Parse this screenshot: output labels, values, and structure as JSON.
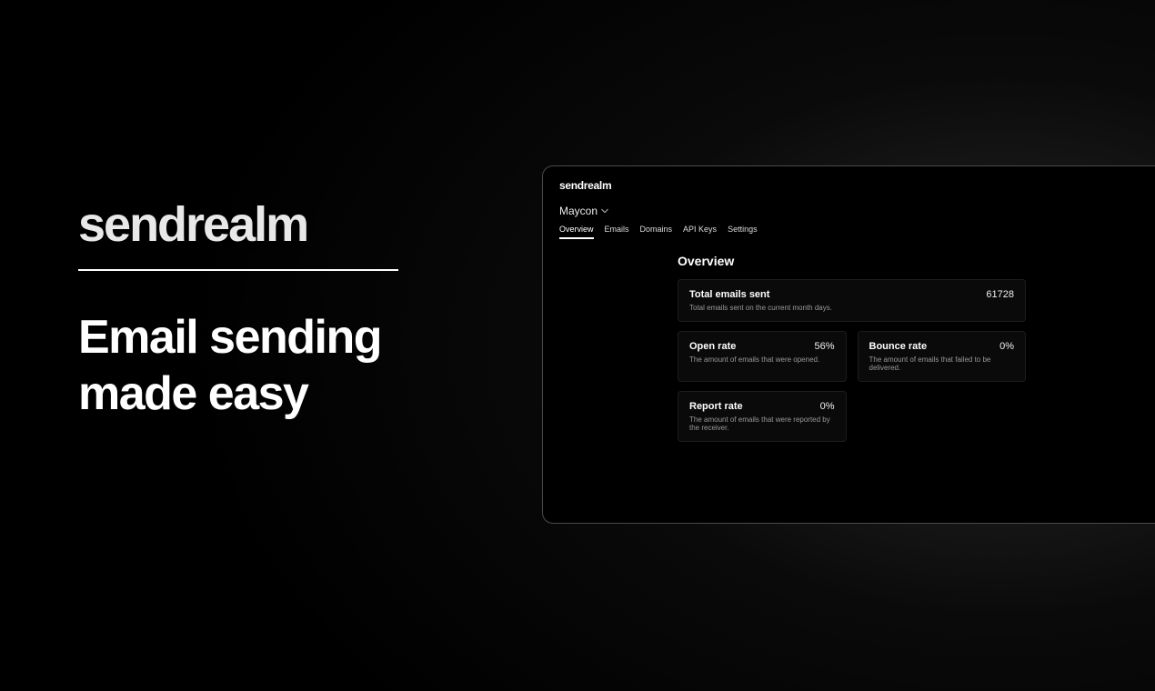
{
  "hero": {
    "brand": "sendrealm",
    "tagline": "Email sending\nmade easy"
  },
  "app": {
    "brand": "sendrealm",
    "user_name": "Maycon",
    "tabs": {
      "overview": "Overview",
      "emails": "Emails",
      "domains": "Domains",
      "api_keys": "API Keys",
      "settings": "Settings"
    },
    "main": {
      "heading": "Overview",
      "cards": {
        "total_sent": {
          "title": "Total emails sent",
          "value": "61728",
          "desc": "Total emails sent on the current month days."
        },
        "open_rate": {
          "title": "Open rate",
          "value": "56%",
          "desc": "The amount of emails that were opened."
        },
        "bounce_rate": {
          "title": "Bounce rate",
          "value": "0%",
          "desc": "The amount of emails that failed to be delivered."
        },
        "report_rate": {
          "title": "Report rate",
          "value": "0%",
          "desc": "The amount of emails that were reported by the receiver."
        }
      }
    }
  }
}
